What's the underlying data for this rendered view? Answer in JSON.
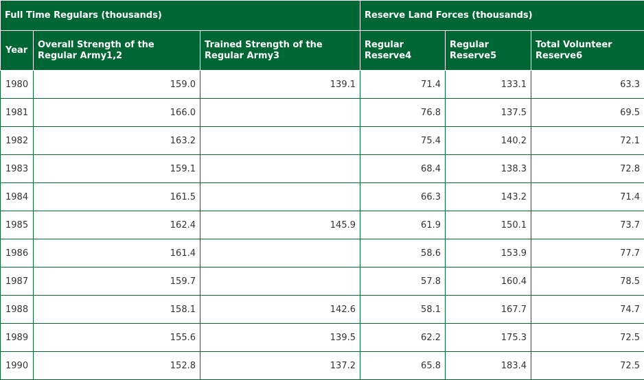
{
  "table": {
    "group_headers": [
      {
        "label": "Full Time Regulars (thousands)",
        "span": 3
      },
      {
        "label": "Reserve Land Forces (thousands)",
        "span": 3
      }
    ],
    "columns": [
      "Year",
      "Overall Strength of the Regular Army1,2",
      "Trained Strength of the Regular Army3",
      "Regular Reserve4",
      "Regular Reserve5",
      "Total Volunteer Reserve6"
    ],
    "rows": [
      [
        "1980",
        "159.0",
        "139.1",
        "71.4",
        "133.1",
        "63.3"
      ],
      [
        "1981",
        "166.0",
        "",
        "76.8",
        "137.5",
        "69.5"
      ],
      [
        "1982",
        "163.2",
        "",
        "75.4",
        "140.2",
        "72.1"
      ],
      [
        "1983",
        "159.1",
        "",
        "68.4",
        "138.3",
        "72.8"
      ],
      [
        "1984",
        "161.5",
        "",
        "66.3",
        "143.2",
        "71.4"
      ],
      [
        "1985",
        "162.4",
        "145.9",
        "61.9",
        "150.1",
        "73.7"
      ],
      [
        "1986",
        "161.4",
        "",
        "58.6",
        "153.9",
        "77.7"
      ],
      [
        "1987",
        "159.7",
        "",
        "57.8",
        "160.4",
        "78.5"
      ],
      [
        "1988",
        "158.1",
        "142.6",
        "58.1",
        "167.7",
        "74.7"
      ],
      [
        "1989",
        "155.6",
        "139.5",
        "62.2",
        "175.3",
        "72.5"
      ],
      [
        "1990",
        "152.8",
        "137.2",
        "65.8",
        "183.4",
        "72.5"
      ]
    ]
  }
}
